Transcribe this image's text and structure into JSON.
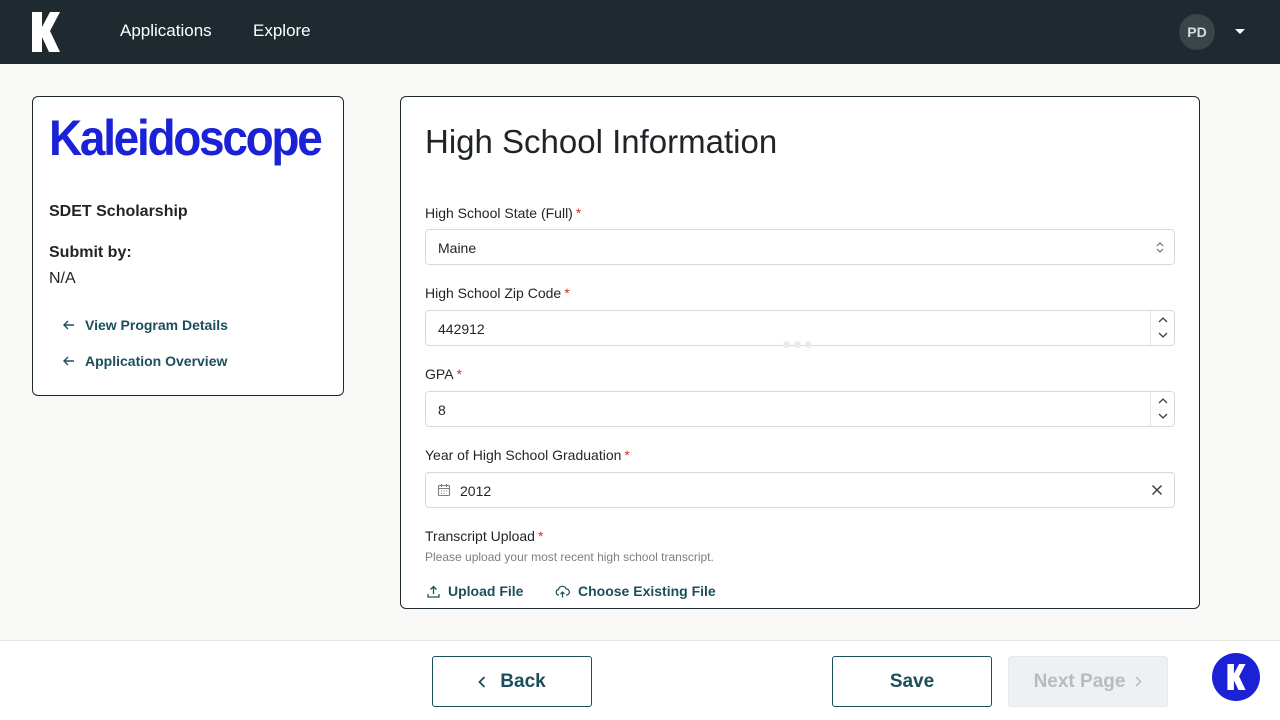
{
  "nav": {
    "logo_icon": "kaleidoscope-k-logo",
    "links": [
      "Applications",
      "Explore"
    ],
    "user_initials": "PD"
  },
  "sidebar": {
    "logo_text": "Kaleidoscope",
    "program_title": "SDET Scholarship",
    "submit_label": "Submit by:",
    "submit_value": "N/A",
    "links": [
      "View Program Details",
      "Application Overview"
    ]
  },
  "form": {
    "title": "High School Information",
    "required_marker": "*",
    "fields": {
      "state": {
        "label": "High School State (Full)",
        "value": "Maine"
      },
      "zip": {
        "label": "High School Zip Code",
        "value": "442912"
      },
      "gpa": {
        "label": "GPA",
        "value": "8"
      },
      "grad_year": {
        "label": "Year of High School Graduation",
        "value": "2012"
      },
      "transcript": {
        "label": "Transcript Upload",
        "help": "Please upload your most recent high school transcript."
      }
    },
    "upload_label": "Upload File",
    "choose_label": "Choose Existing File"
  },
  "footer": {
    "back_label": "Back",
    "save_label": "Save",
    "next_label": "Next Page"
  },
  "colors": {
    "topbar": "#1e2a2f",
    "brand_blue": "#1b22d6",
    "link_teal": "#1c4e5c",
    "required_red": "#d93025"
  }
}
